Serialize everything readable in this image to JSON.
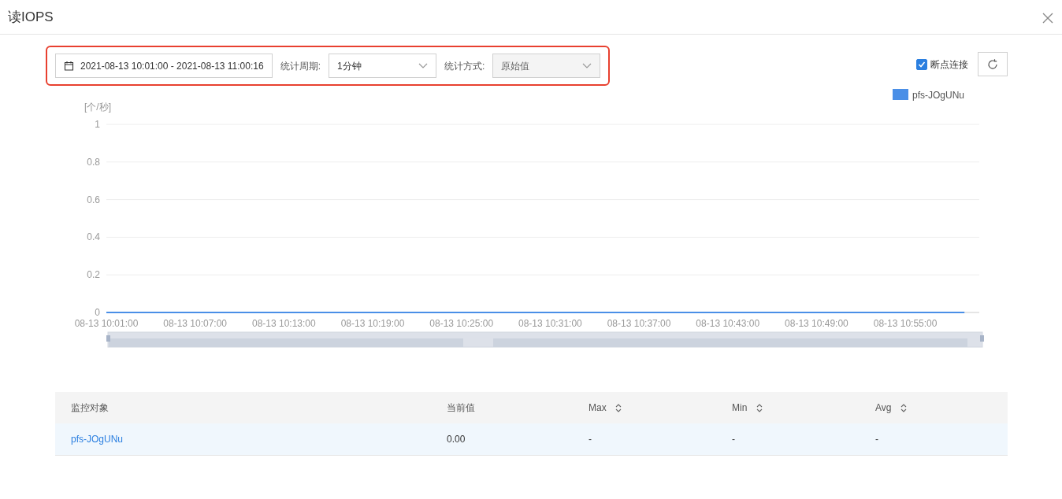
{
  "window": {
    "title": "读IOPS"
  },
  "toolbar": {
    "time_range": "2021-08-13 10:01:00 - 2021-08-13 11:00:16",
    "period_label": "统计周期:",
    "period_value": "1分钟",
    "method_label": "统计方式:",
    "method_value": "原始值",
    "method_disabled": true,
    "reconnect_label": "断点连接",
    "reconnect_checked": true
  },
  "chart": {
    "chart_data": {
      "type": "line",
      "ylabel": "[个/秒]",
      "categories": [
        "08-13 10:01:00",
        null,
        null,
        null,
        null,
        null,
        "08-13 10:07:00",
        null,
        null,
        null,
        null,
        null,
        "08-13 10:13:00",
        null,
        null,
        null,
        null,
        null,
        "08-13 10:19:00",
        null,
        null,
        null,
        null,
        null,
        "08-13 10:25:00",
        null,
        null,
        null,
        null,
        null,
        "08-13 10:31:00",
        null,
        null,
        null,
        null,
        null,
        "08-13 10:37:00",
        null,
        null,
        null,
        null,
        null,
        "08-13 10:43:00",
        null,
        null,
        null,
        null,
        null,
        "08-13 10:49:00",
        null,
        null,
        null,
        null,
        null,
        "08-13 10:55:00",
        null,
        null,
        null,
        null
      ],
      "series": [
        {
          "name": "pfs-JOgUNu",
          "color": "#4a8fe7",
          "values": [
            0,
            0,
            0,
            0,
            0,
            0,
            0,
            0,
            0,
            0,
            0,
            0,
            0,
            0,
            0,
            0,
            0,
            0,
            0,
            0,
            0,
            0,
            0,
            0,
            0,
            0,
            0,
            0,
            0,
            0,
            0,
            0,
            0,
            0,
            0,
            0,
            0,
            0,
            0,
            0,
            0,
            0,
            0,
            0,
            0,
            0,
            0,
            0,
            0,
            0,
            0,
            0,
            0,
            0,
            0,
            0,
            0,
            0,
            0
          ]
        }
      ],
      "ylim": [
        0,
        1
      ],
      "grid": true,
      "yticks": [
        0,
        0.2,
        0.4,
        0.6,
        0.8,
        1
      ]
    }
  },
  "table": {
    "columns": [
      {
        "label": "监控对象",
        "sortable": false
      },
      {
        "label": "当前值",
        "sortable": false
      },
      {
        "label": "Max",
        "sortable": true
      },
      {
        "label": "Min",
        "sortable": true
      },
      {
        "label": "Avg",
        "sortable": true
      }
    ],
    "rows": [
      {
        "cells": [
          "pfs-JOgUNu",
          "0.00",
          "-",
          "-",
          "-"
        ]
      }
    ]
  }
}
